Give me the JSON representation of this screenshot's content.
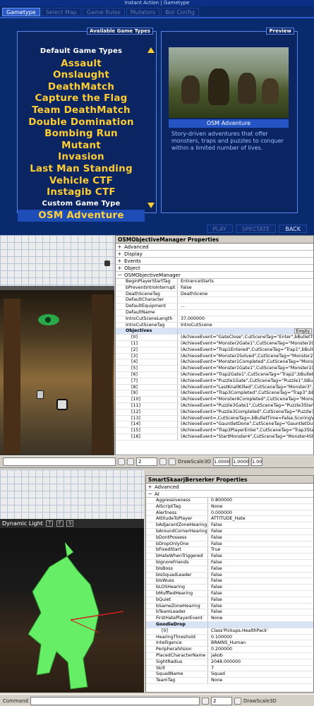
{
  "gametypes": {
    "window_title": "Instant Action | Gametype",
    "tabs": [
      "Gametype",
      "Select Map",
      "Game Rules",
      "Mutators",
      "Bot Config"
    ],
    "list_header": "Available Game Types",
    "items": [
      {
        "label": "Default Game Types",
        "kind": "header"
      },
      {
        "label": "Assault",
        "kind": "item"
      },
      {
        "label": "Onslaught",
        "kind": "item"
      },
      {
        "label": "DeathMatch",
        "kind": "item"
      },
      {
        "label": "Capture the Flag",
        "kind": "item"
      },
      {
        "label": "Team DeathMatch",
        "kind": "item"
      },
      {
        "label": "Double Domination",
        "kind": "item"
      },
      {
        "label": "Bombing Run",
        "kind": "item"
      },
      {
        "label": "Mutant",
        "kind": "item"
      },
      {
        "label": "Invasion",
        "kind": "item"
      },
      {
        "label": "Last Man Standing",
        "kind": "item"
      },
      {
        "label": "Vehicle CTF",
        "kind": "item"
      },
      {
        "label": "Instagib CTF",
        "kind": "item"
      },
      {
        "label": "Custom Game Type",
        "kind": "header"
      },
      {
        "label": "OSM Adventure",
        "kind": "selected"
      }
    ],
    "preview_header": "Preview",
    "preview_caption": "OSM Adventure",
    "preview_desc": "Story-driven adventures that offer monsters, traps and puzzles to conquer within a limited number of lives.",
    "buttons": [
      "PLAY",
      "SPECTATE",
      "BACK"
    ]
  },
  "objective_props": {
    "title": "OSMObjectiveManager Properties",
    "categories": [
      "Advanced",
      "Display",
      "Events",
      "Object",
      "OSMObjectiveManager"
    ],
    "rows": [
      {
        "k": "BeginPlayerStartTag",
        "v": "EntranceStarts"
      },
      {
        "k": "bPreventIntroInterrupt",
        "v": "False"
      },
      {
        "k": "DeathSceneTag",
        "v": "DeathScene"
      },
      {
        "k": "DefaultCharacter",
        "v": ""
      },
      {
        "k": "DefaultEquipment",
        "v": "..."
      },
      {
        "k": "DefaultName",
        "v": ""
      },
      {
        "k": "IntroCutSceneLength",
        "v": "37.000000"
      },
      {
        "k": "IntroCutSceneTag",
        "v": "IntroCutScene"
      }
    ],
    "objectives_label": "Objectives",
    "empty_label": "Empty",
    "objectives": [
      {
        "k": "[0]",
        "v": "(AchieveEvent=\"GateClose\",CutSceneTag=\"Enter\",bBulletTime=False"
      },
      {
        "k": "[1]",
        "v": "(AchieveEvent=\"Monster2Gate1\",CutSceneTag=\"Monster2Gate1\",bBulletTime=False,S"
      },
      {
        "k": "[2]",
        "v": "(AchieveEvent=\"Trap1Entered\",CutSceneTag=\"Trap1\",bBulletTime=False,Sc"
      },
      {
        "k": "[3]",
        "v": "(AchieveEvent=\"Monster2Solved\",CutSceneTag=\"Monster2\",bBulletTime"
      },
      {
        "k": "[4]",
        "v": "(AchieveEvent=\"Monster1Completed\",CutSceneTag=\"Monster1\",bBul"
      },
      {
        "k": "[5]",
        "v": "(AchieveEvent=\"Monster1Gate1\",CutSceneTag=\"Monster1Gate1\",bBulletTime=False,S"
      },
      {
        "k": "[6]",
        "v": "(AchieveEvent=\"Trap2Gate1\",CutSceneTag=\"Trap2\",bBulletTime=False,S"
      },
      {
        "k": "[7]",
        "v": "(AchieveEvent=\"Puzzle1Gate\",CutSceneTag=\"Puzzle1\",bBulletTime"
      },
      {
        "k": "[8]",
        "v": "(AchieveEvent=\"LastKnallKilled\",CutSceneTag=\"Monster3\",bBulletTim"
      },
      {
        "k": "[9]",
        "v": "(AchieveEvent=\"Trap3Completed\",CutSceneTag=\"Trap3\",bBulletTim"
      },
      {
        "k": "[10]",
        "v": "(AchieveEvent=\"Monster4Completed\",CutSceneTag=\"Monster4End\""
      },
      {
        "k": "[11]",
        "v": "(AchieveEvent=\"Puzzle3Gate1\",CutSceneTag=\"Puzzle3Start\",bBulletTi"
      },
      {
        "k": "[12]",
        "v": "(AchieveEvent=\"Puzzle3Completed\",CutSceneTag=\"Puzzle3End\",bB"
      },
      {
        "k": "[13]",
        "v": "(AchieveEvent=,CutSceneTag=,bBulletTime=False,ScoringValue=0,A"
      },
      {
        "k": "[14]",
        "v": "(AchieveEvent=\"GauntletDone\",CutSceneTag=\"GauntletOutto\",bBulle"
      },
      {
        "k": "[15]",
        "v": "(AchieveEvent=\"Trap3PlayerEnter\",CutSceneTag=\"Trap3Start\",bBullet"
      },
      {
        "k": "[16]",
        "v": "(AchieveEvent=\"StartMonster4\",CutSceneTag=\"Monster4Start\",bBull"
      }
    ]
  },
  "toolbar": {
    "grid_value": "2",
    "drawscale_label": "DrawScale3D",
    "scale_x": "1.0000",
    "scale_y": "1.0000",
    "scale_z": "1.00"
  },
  "viewport": {
    "label": "Dynamic Light",
    "buttons": [
      "T",
      "F",
      "S"
    ]
  },
  "skaarj_props": {
    "title": "SmartSkaarjBerserker Properties",
    "categories_closed": [
      "Advanced"
    ],
    "ai_label": "AI",
    "rows": [
      {
        "k": "Aggressiveness",
        "v": "0.800000"
      },
      {
        "k": "AIScriptTag",
        "v": "None"
      },
      {
        "k": "Alertness",
        "v": "0.000000"
      },
      {
        "k": "AttitudeToPlayer",
        "v": "ATTITUDE_Hate"
      },
      {
        "k": "bAdjacentZoneHearing",
        "v": "False"
      },
      {
        "k": "bAroundCornerHearing",
        "v": "False"
      },
      {
        "k": "bDontPossess",
        "v": "False"
      },
      {
        "k": "bDropOnlyOne",
        "v": "False"
      },
      {
        "k": "bFixedStart",
        "v": "True"
      },
      {
        "k": "bHateWhenTriggered",
        "v": "False"
      },
      {
        "k": "bIgnoreFriends",
        "v": "False"
      },
      {
        "k": "bIsBoss",
        "v": "False"
      },
      {
        "k": "bIsSquadLeader",
        "v": "False"
      },
      {
        "k": "bIsWuss",
        "v": "False"
      },
      {
        "k": "bLOSHearing",
        "v": "False"
      },
      {
        "k": "bMuffledHearing",
        "v": "False"
      },
      {
        "k": "bQuiet",
        "v": "False"
      },
      {
        "k": "bSameZoneHearing",
        "v": "False"
      },
      {
        "k": "bTeamLeader",
        "v": "False"
      },
      {
        "k": "FirstHatePlayerEvent",
        "v": "None"
      }
    ],
    "goodie_label": "GoodieDrop",
    "goodie_rows": [
      {
        "k": "[0]",
        "v": "Class'Pickups.HealthPack'"
      }
    ],
    "rows2": [
      {
        "k": "HearingThreshold",
        "v": "0.100000"
      },
      {
        "k": "Intelligence",
        "v": "BRAINS_Human"
      },
      {
        "k": "PeripheralVision",
        "v": "0.200000"
      },
      {
        "k": "PlacedCharacterName",
        "v": "jakob"
      },
      {
        "k": "SightRadius",
        "v": "2048.000000"
      },
      {
        "k": "Skill",
        "v": "7"
      },
      {
        "k": "SquadName",
        "v": "Squad"
      },
      {
        "k": "TeamTag",
        "v": "None"
      }
    ]
  },
  "statusbar": {
    "command_label": "Command",
    "grid_value": "2",
    "drawscale_label": "DrawScale3D"
  }
}
